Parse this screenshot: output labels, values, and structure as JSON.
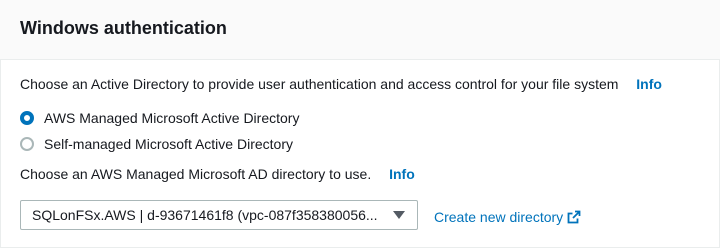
{
  "section": {
    "title": "Windows authentication"
  },
  "description": {
    "text": "Choose an Active Directory to provide user authentication and access control for your file system",
    "info_label": "Info"
  },
  "radio_options": [
    {
      "label": "AWS Managed Microsoft Active Directory",
      "checked": true
    },
    {
      "label": "Self-managed Microsoft Active Directory",
      "checked": false
    }
  ],
  "directory_select": {
    "label": "Choose an AWS Managed Microsoft AD directory to use.",
    "info_label": "Info",
    "value": "SQLonFSx.AWS | d-93671461f8 (vpc-087f358380056...",
    "icon": "caret-down-icon"
  },
  "create_link": {
    "label": "Create new directory",
    "icon": "external-link-icon"
  },
  "colors": {
    "accent": "#0073bb",
    "header_bg": "#fafafa",
    "text": "#16191f",
    "border": "#aab7b8"
  }
}
